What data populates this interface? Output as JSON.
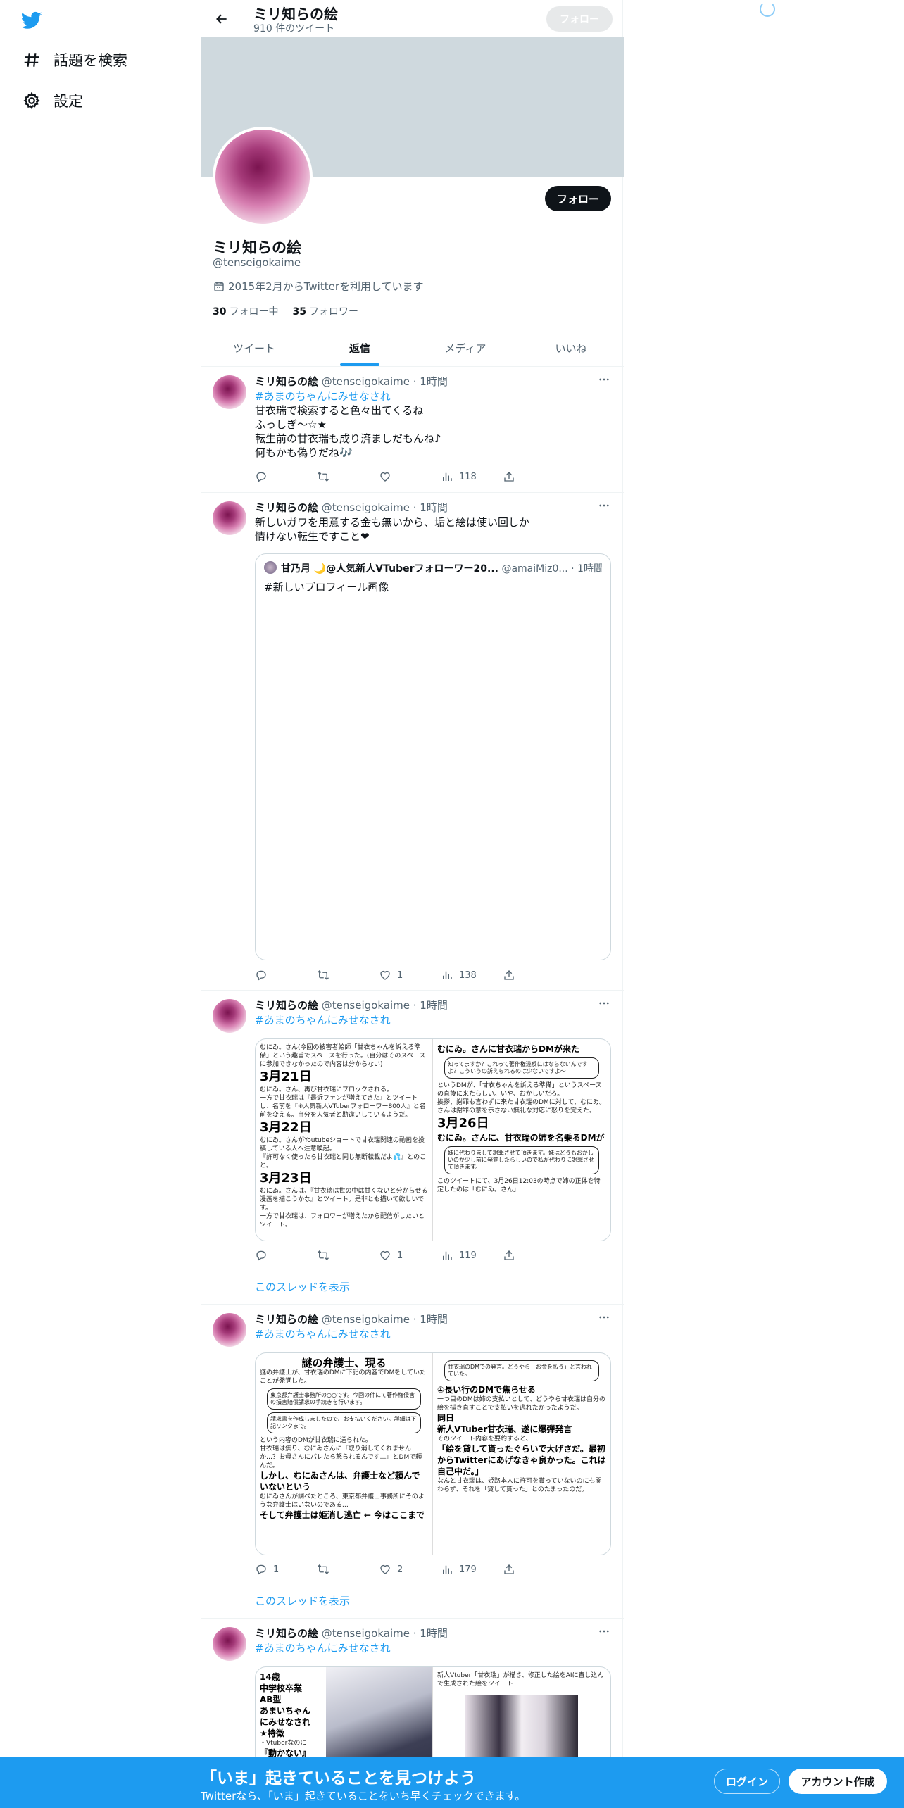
{
  "nav": {
    "items": [
      {
        "label": "話題を検索",
        "icon": "hashtag-icon"
      },
      {
        "label": "設定",
        "icon": "gear-icon"
      }
    ]
  },
  "header": {
    "name": "ミリ知らの絵",
    "tweet_count": "910 件のツイート",
    "follow_label": "フォロー"
  },
  "profile": {
    "name": "ミリ知らの絵",
    "handle": "@tenseigokaime",
    "joined": "2015年2月からTwitterを利用しています",
    "following_count": "30",
    "following_label": "フォロー中",
    "followers_count": "35",
    "followers_label": "フォロワー",
    "follow_label": "フォロー"
  },
  "tabs": [
    "ツイート",
    "返信",
    "メディア",
    "いいね"
  ],
  "tweets": [
    {
      "name": "ミリ知らの絵",
      "handle": "@tenseigokaime",
      "time": "· 1時間",
      "hashtag": "#あまのちゃんにみせなされ",
      "lines": [
        "甘衣瑞で検索すると色々出てくるね",
        "ふっしぎ～☆★",
        "転生前の甘衣瑞も成り済ましだもんね♪",
        "何もかも偽りだね🎶"
      ],
      "replies": "",
      "retweets": "",
      "likes": "",
      "views": "118"
    },
    {
      "name": "ミリ知らの絵",
      "handle": "@tenseigokaime",
      "time": "· 1時間",
      "lines": [
        "新しいガワを用意する金も無いから、垢と絵は使い回しか",
        "情けない転生ですこと❤"
      ],
      "quote": {
        "name": "甘乃月 🌙@人気新人VTuberフォローワー20...",
        "handle": "@amaiMiz0...",
        "time": "· 1時間",
        "text": "#新しいプロフィール画像"
      },
      "replies": "",
      "retweets": "",
      "likes": "1",
      "views": "138"
    },
    {
      "name": "ミリ知らの絵",
      "handle": "@tenseigokaime",
      "time": "· 1時間",
      "hashtag": "#あまのちゃんにみせなされ",
      "panel_left": {
        "intro": "むにゐ。さん(今回の被害者絵師「甘衣ちゃんを訴える準備」という趣旨でスペースを行った。(自分はそのスペースに参加できなかったので内容は分からない)",
        "d1": "3月21日",
        "t1": "むにゐ。さん、再び甘衣瑞にブロックされる。",
        "t1b": "一方で甘衣瑞は『最近ファンが増えてきた』とツイートし、名前を『※人気新人VTuberフォローワー800人』と名前を変える。自分を人気者と勘違いしているようだ。",
        "d2": "3月22日",
        "t2": "むにゐ。さんがYoutubeショートで甘衣瑞関連の動画を投稿している人へ注意喚起。",
        "t2b": "『許可なく使ったら甘衣瑞と同じ無断転載だよ💦』とのこと。",
        "d3": "3月23日",
        "t3": "むにゐ。さんは、『甘衣瑞は世の中は甘くないと分からせる漫画を描こうかな』とツイート。是非とも描いて欲しいです。",
        "t3b": "一方で甘衣瑞は、フォロワーが増えたから配信がしたいとツイート。"
      },
      "panel_right": {
        "head": "むにゐ。さんに甘衣瑞からDMが来た",
        "b1": "知ってますか？これって著作権違反にはならないんですよ？こういうの訴えられるのは少ないですよ～",
        "t1": "というDMが、「甘衣ちゃんを訴える準備」というスペースの直後に来たらしい。いや、おかしいだろ。",
        "t1b": "挨拶、謝罪も言わずに来た甘衣瑞のDMに対して、むにゐ。さんは謝罪の意を示さない無礼な対応に怒りを覚えた。",
        "d1": "3月26日",
        "t2": "むにゐ。さんに、甘衣瑞の姉を名乗るDMが",
        "b2": "妹に代わりまして謝罪させて頂きます。妹はどうもおかしいのか少し前に発覚したらしいので私が代わりに謝罪させて頂きます。",
        "t3": "このツイートにて、3月26日12:03の時点で姉の正体を特定したのは「むにゐ。さん」"
      },
      "replies": "",
      "retweets": "",
      "likes": "1",
      "views": "119",
      "thread": "このスレッドを表示"
    },
    {
      "name": "ミリ知らの絵",
      "handle": "@tenseigokaime",
      "time": "· 1時間",
      "hashtag": "#あまのちゃんにみせなされ",
      "panel_left": {
        "title": "謎の弁護士、現る",
        "t1": "謎の弁護士が、甘衣瑞のDMに下記の内容でDMをしていたことが発覚した。",
        "b1": "東京都弁護士事務所の○○です。今回の件にて著作権侵害の損害賠償請求の手続きを行います。",
        "b2": "請求書を作成しましたので、お支払いください。詳細は下記リンクまで。",
        "t2": "という内容のDMが甘衣瑞に送られた。",
        "t3": "甘衣瑞は焦り、むにゐさんに『取り消してくれませんか…？お母さんにバレたら怒られるんです…』とDMで頼んだ。",
        "t4": "しかし、むにゐさんは、弁護士など頼んでいないという",
        "t5": "むにゐさんが調べたところ、東京都弁護士事務所にそのような弁護士はいないのである…",
        "t6": "そして弁護士は姫消し逃亡 ← 今はここまで"
      },
      "panel_right": {
        "b1": "甘衣瑞のDMでの発言。どうやら「お金を払う」と言われていた。",
        "h1": "①長い行のDMで焦らせる",
        "t1": "一つ目のDMは姉の支払いとして、どうやら甘衣瑞は自分の絵を描き直すことで支払いを逃れたかったようだ。",
        "d1": "同日",
        "h2": "新人VTuber甘衣瑞、遂に爆弾発言",
        "t2": "そのツイート内容を要約すると、",
        "q": "「絵を貸して貰ったぐらいで大げさだ。最初からTwitterにあげなきゃ良かった。これは自己中だ。」",
        "t3": "なんと甘衣瑞は、姫路本人に許可を貰っていないのにも関わらず、それを「貸して貰った」とのたまったのだ。"
      },
      "replies": "1",
      "retweets": "",
      "likes": "2",
      "views": "179",
      "thread": "このスレッドを表示"
    },
    {
      "name": "ミリ知らの絵",
      "handle": "@tenseigokaime",
      "time": "· 1時間",
      "hashtag": "#あまのちゃんにみせなされ",
      "panel_left": {
        "a": "14歳",
        "b": "中学校卒業",
        "c": "AB型",
        "d": "あまいちゃん",
        "e": "にみせなされ",
        "f": "★特徴",
        "g": "・Vtuberなのに",
        "h": "『動かない』"
      },
      "panel_right": {
        "t1": "新人Vtuber「甘衣瑞」が描き、修正した絵をAIに直し込んで生成された絵をツイート"
      }
    }
  ],
  "bottom_bar": {
    "title": "「いま」起きていることを見つけよう",
    "subtitle": "Twitterなら、「いま」起きていることをいち早くチェックできます。",
    "login_label": "ログイン",
    "signup_label": "アカウント作成"
  },
  "colors": {
    "accent": "#1d9bf0",
    "text": "#0f1419",
    "muted": "#536471",
    "heart": "#f91880"
  }
}
